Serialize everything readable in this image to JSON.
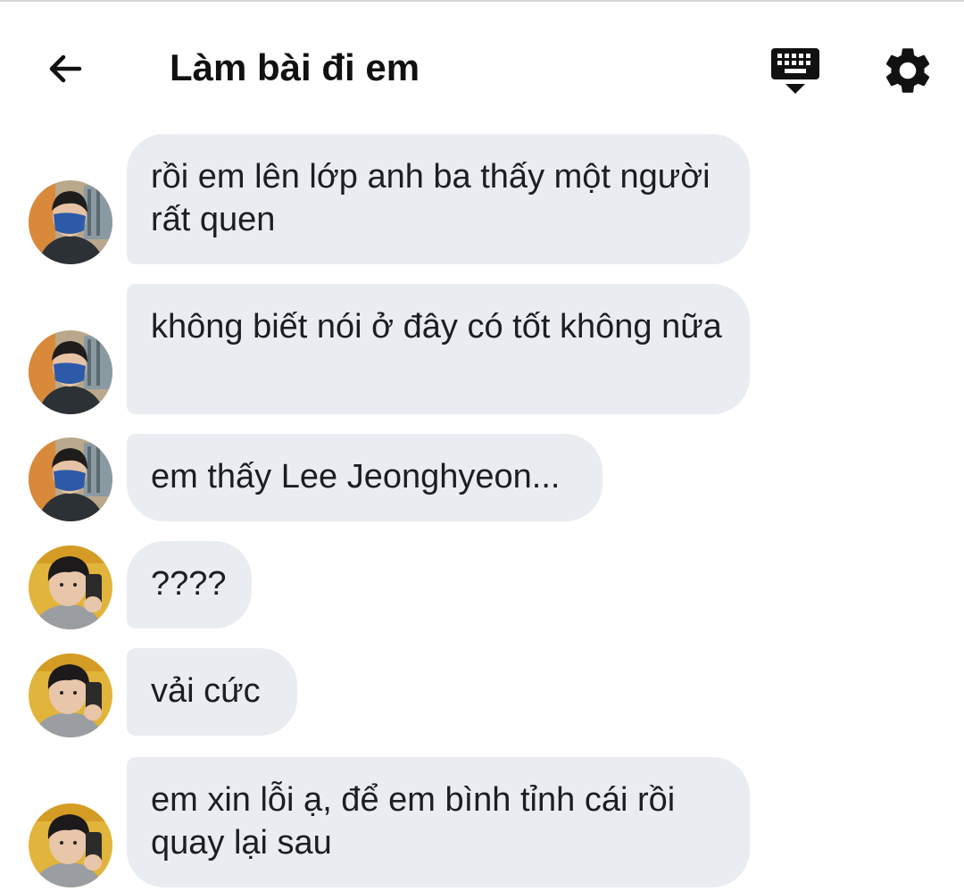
{
  "header": {
    "title": "Làm bài đi em",
    "back_icon": "arrow-left-icon",
    "keyboard_icon": "keyboard-hide-icon",
    "settings_icon": "gear-icon"
  },
  "colors": {
    "bubble_bg": "#e9ecf0",
    "text": "#1c1e21",
    "header_text": "#111111"
  },
  "messages": [
    {
      "sender": "masked-user",
      "text": "rồi em lên lớp anh ba thấy một người rất quen"
    },
    {
      "sender": "masked-user",
      "text": "không biết nói ở đây có tốt không nữa"
    },
    {
      "sender": "masked-user",
      "text": "em thấy Lee Jeonghyeon..."
    },
    {
      "sender": "phone-user",
      "text": "????"
    },
    {
      "sender": "phone-user",
      "text": "vải cức"
    },
    {
      "sender": "phone-user",
      "text": "em xin lỗi ạ, để em bình tỉnh cái rồi quay lại sau"
    }
  ]
}
